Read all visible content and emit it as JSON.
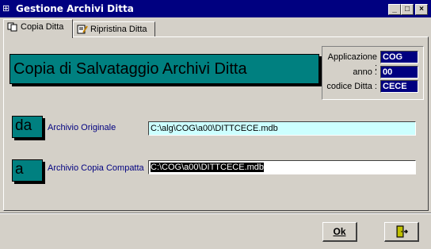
{
  "window": {
    "title": "Gestione Archivi Ditta",
    "controls": [
      "_",
      "□",
      "×"
    ]
  },
  "tabs": [
    {
      "label": "Copia Ditta",
      "icon": "copy-icon",
      "active": true
    },
    {
      "label": "Ripristina Ditta",
      "icon": "restore-icon",
      "active": false
    }
  ],
  "main": {
    "title": "Copia di Salvataggio Archivi Ditta"
  },
  "info": {
    "applicazione_label": "Applicazione :",
    "applicazione_value": "COG",
    "anno_label": "anno :",
    "anno_value": "00",
    "codice_label": "codice Ditta :",
    "codice_value": "CECE"
  },
  "source": {
    "badge": "da",
    "label": "Archivio Originale",
    "value": "C:\\alg\\COG\\a00\\DITTCECE.mdb"
  },
  "dest": {
    "badge": "a",
    "label": "Archivio Copia Compatta",
    "value": "C:\\COG\\a00\\DITTCECE.mdb"
  },
  "buttons": {
    "ok": "Ok",
    "exit_icon": "exit-door-icon"
  },
  "colors": {
    "titlebar": "#000080",
    "teal": "#008080",
    "source_field": "#ccffff"
  }
}
